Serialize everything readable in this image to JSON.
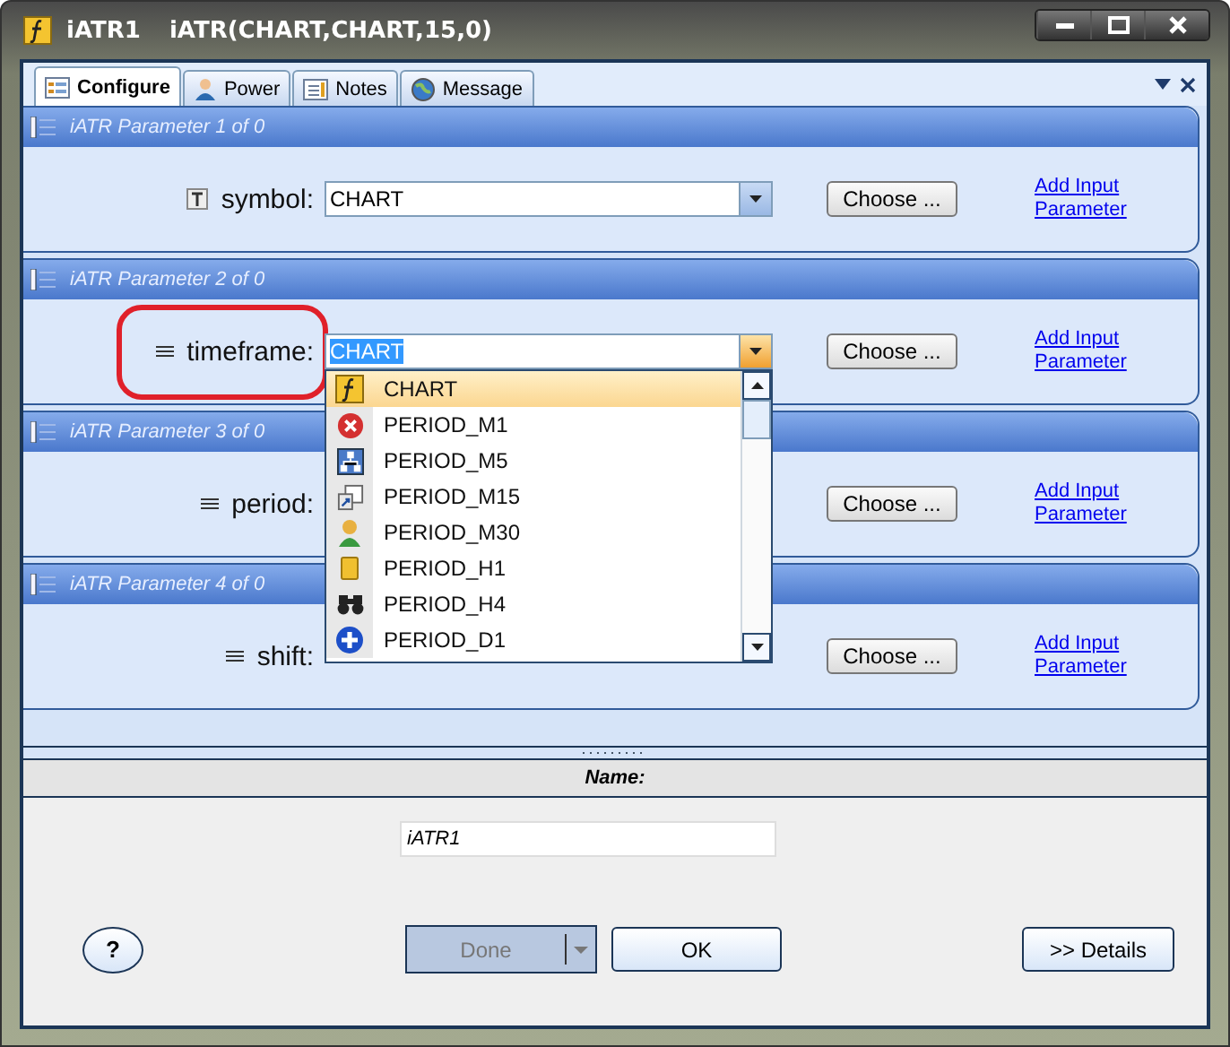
{
  "window": {
    "name": "iATR1",
    "title": "iATR(CHART,CHART,15,0)"
  },
  "tabs": [
    {
      "label": "Configure",
      "selected": true,
      "kind": "configure"
    },
    {
      "label": "Power",
      "selected": false,
      "kind": "power"
    },
    {
      "label": "Notes",
      "selected": false,
      "kind": "notes"
    },
    {
      "label": "Message",
      "selected": false,
      "kind": "message"
    }
  ],
  "parameters": [
    {
      "header": "iATR Parameter 1 of 0",
      "label": "symbol:",
      "kind": "text",
      "value": "CHART",
      "open": false,
      "highlighted": false,
      "choose": "Choose ...",
      "link": "Add Input Parameter"
    },
    {
      "header": "iATR Parameter 2 of 0",
      "label": "timeframe:",
      "kind": "enum",
      "value": "CHART",
      "open": true,
      "highlighted": true,
      "choose": "Choose ...",
      "link": "Add Input Parameter"
    },
    {
      "header": "iATR Parameter 3 of 0",
      "label": "period:",
      "kind": "enum",
      "choose": "Choose ...",
      "link": "Add Input Parameter"
    },
    {
      "header": "iATR Parameter 4 of 0",
      "label": "shift:",
      "kind": "enum",
      "choose": "Choose ...",
      "link": "Add Input Parameter"
    }
  ],
  "dropdown": {
    "items": [
      {
        "label": "CHART",
        "kind": "function",
        "selected": true
      },
      {
        "label": "PERIOD_M1",
        "kind": "error",
        "selected": false
      },
      {
        "label": "PERIOD_M5",
        "kind": "network",
        "selected": false
      },
      {
        "label": "PERIOD_M15",
        "kind": "shortcut",
        "selected": false
      },
      {
        "label": "PERIOD_M30",
        "kind": "person",
        "selected": false
      },
      {
        "label": "PERIOD_H1",
        "kind": "cylinder",
        "selected": false
      },
      {
        "label": "PERIOD_H4",
        "kind": "binoculars",
        "selected": false
      },
      {
        "label": "PERIOD_D1",
        "kind": "plus",
        "selected": false
      }
    ]
  },
  "name_section": {
    "label": "Name:",
    "value": "iATR1"
  },
  "buttons": {
    "help": "?",
    "done": {
      "label": "Done",
      "disabled": true
    },
    "ok": "OK",
    "details": ">> Details"
  }
}
